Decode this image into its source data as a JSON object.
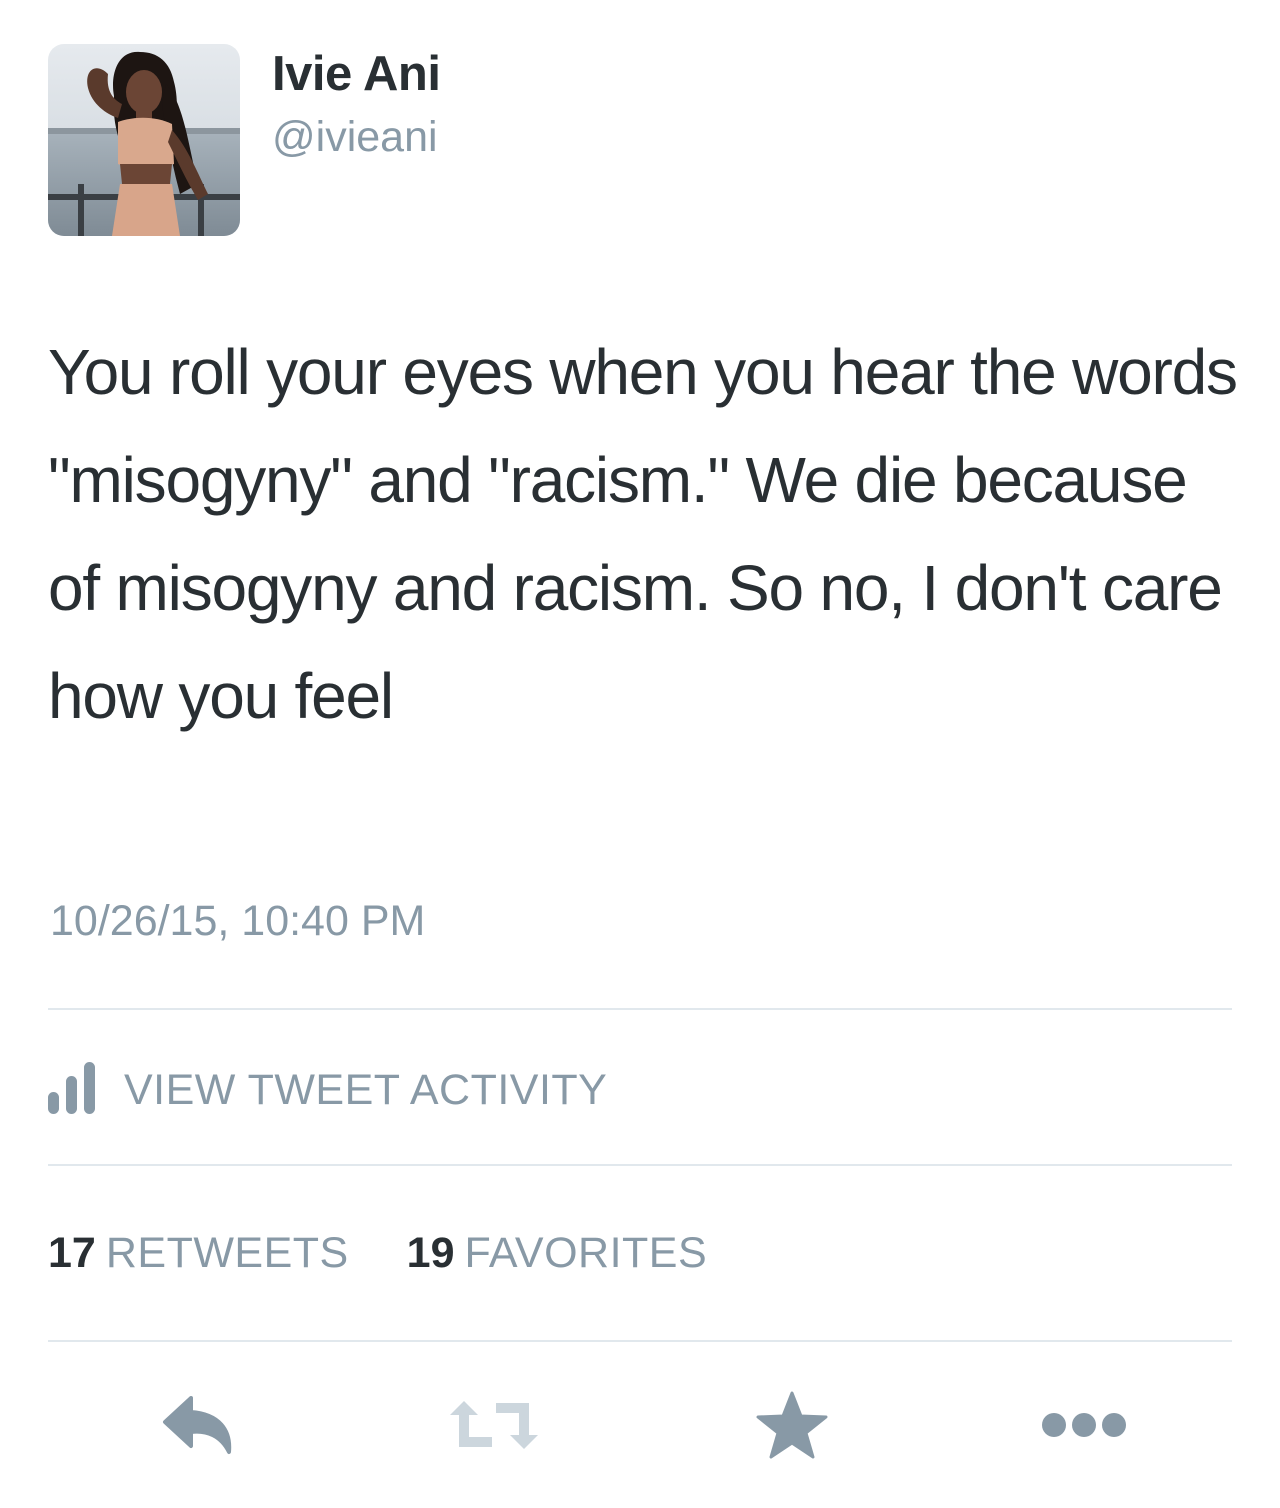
{
  "tweet": {
    "user": {
      "display_name": "Ivie Ani",
      "handle": "@ivieani"
    },
    "text": "You roll your eyes when you hear the words \"misogyny\" and \"racism.\" We die because of misogyny and racism. So no, I don't care how you feel",
    "timestamp": "10/26/15, 10:40 PM"
  },
  "activity": {
    "label": "VIEW TWEET ACTIVITY",
    "icon": "bar-chart-icon"
  },
  "stats": {
    "retweets_count": "17",
    "retweets_label": "RETWEETS",
    "favorites_count": "19",
    "favorites_label": "FAVORITES"
  },
  "actions": {
    "reply_icon": "reply-icon",
    "retweet_icon": "retweet-icon",
    "favorite_icon": "star-icon",
    "more_icon": "more-icon"
  },
  "colors": {
    "text_primary": "#292f33",
    "text_secondary": "#8899a6",
    "divider": "#e1e8ed",
    "retweet_icon_disabled": "#ccd6dd"
  }
}
